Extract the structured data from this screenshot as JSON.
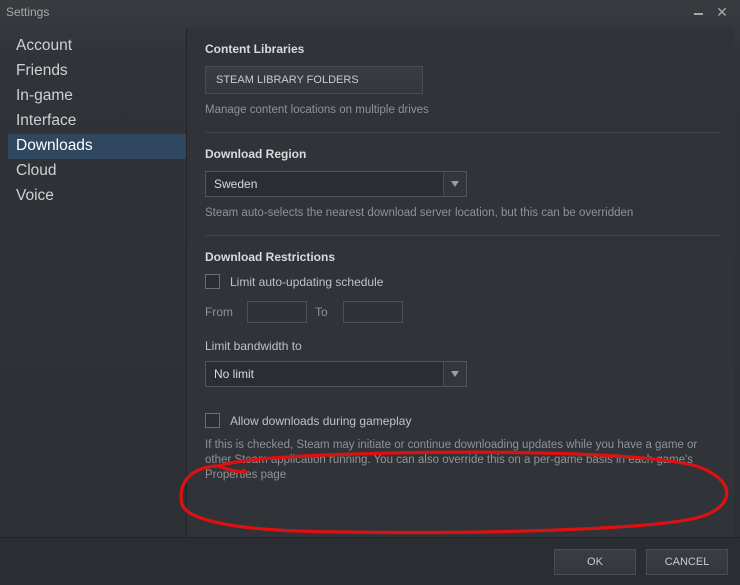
{
  "window": {
    "title": "Settings"
  },
  "sidebar": {
    "items": [
      {
        "label": "Account"
      },
      {
        "label": "Friends"
      },
      {
        "label": "In-game"
      },
      {
        "label": "Interface"
      },
      {
        "label": "Downloads",
        "selected": true
      },
      {
        "label": "Cloud"
      },
      {
        "label": "Voice"
      }
    ]
  },
  "content_libraries": {
    "title": "Content Libraries",
    "button": "STEAM LIBRARY FOLDERS",
    "hint": "Manage content locations on multiple drives"
  },
  "download_region": {
    "title": "Download Region",
    "value": "Sweden",
    "hint": "Steam auto-selects the nearest download server location, but this can be overridden"
  },
  "restrictions": {
    "title": "Download Restrictions",
    "limit_schedule_label": "Limit auto-updating schedule",
    "from_label": "From",
    "to_label": "To",
    "from_value": "",
    "to_value": "",
    "bandwidth_label": "Limit bandwidth to",
    "bandwidth_value": "No limit",
    "allow_gameplay_label": "Allow downloads during gameplay",
    "allow_gameplay_desc": "If this is checked, Steam may initiate or continue downloading updates while you have a game or other Steam application running. You can also override this on a per-game basis in each game's Properties page"
  },
  "footer": {
    "ok": "OK",
    "cancel": "CANCEL"
  }
}
